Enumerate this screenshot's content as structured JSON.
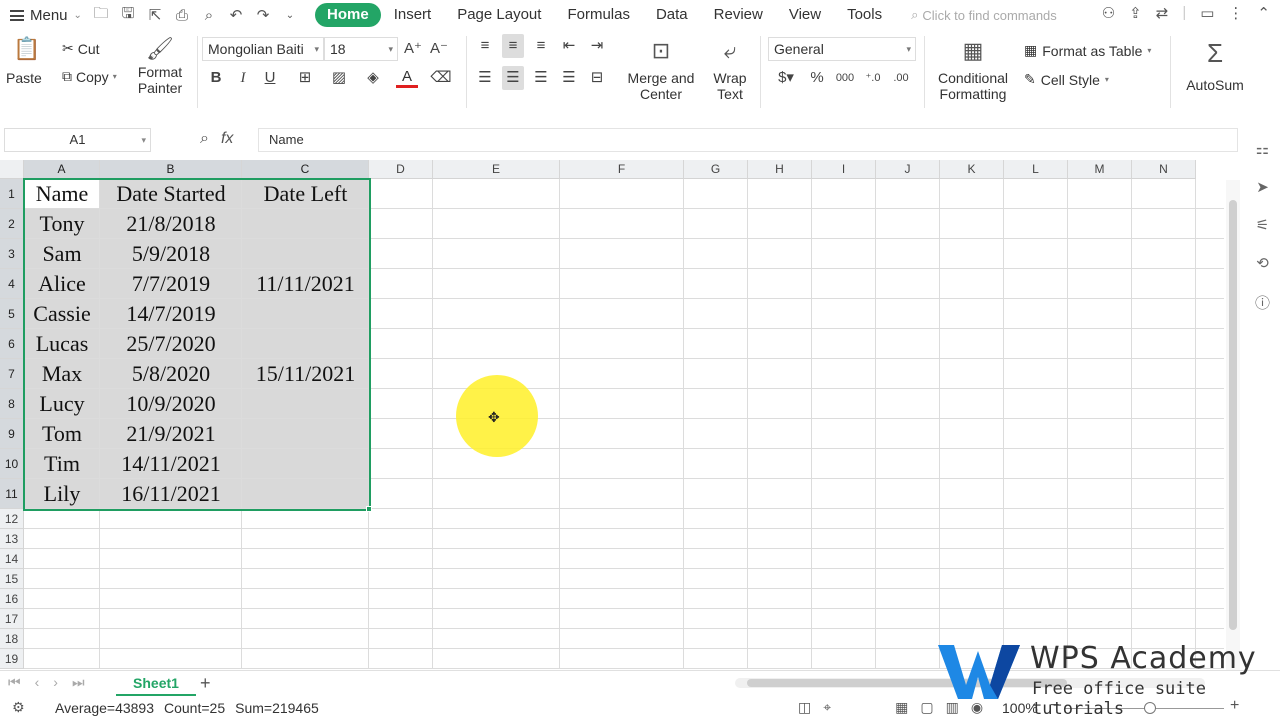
{
  "menubar": {
    "menu_label": "Menu",
    "tabs": [
      {
        "label": "Home",
        "active": true
      },
      {
        "label": "Insert"
      },
      {
        "label": "Page Layout"
      },
      {
        "label": "Formulas"
      },
      {
        "label": "Data"
      },
      {
        "label": "Review"
      },
      {
        "label": "View"
      },
      {
        "label": "Tools"
      }
    ],
    "search_placeholder": "Click to find commands"
  },
  "ribbon": {
    "paste": "Paste",
    "cut": "Cut",
    "copy": "Copy",
    "format_painter_1": "Format",
    "format_painter_2": "Painter",
    "font_name": "Mongolian Baiti",
    "font_size": "18",
    "merge_1": "Merge and",
    "merge_2": "Center",
    "wrap_1": "Wrap",
    "wrap_2": "Text",
    "number_format": "General",
    "conditional_1": "Conditional",
    "conditional_2": "Formatting",
    "format_as_table": "Format as Table",
    "cell_style": "Cell Style",
    "autosum": "AutoSum",
    "bold": "B",
    "italic": "I",
    "underline": "U",
    "percent": "%"
  },
  "formula_bar": {
    "name_box": "A1",
    "fx": "fx",
    "content": "Name"
  },
  "grid": {
    "columns": [
      "A",
      "B",
      "C",
      "D",
      "E",
      "F",
      "G",
      "H",
      "I",
      "J",
      "K",
      "L",
      "M",
      "N"
    ],
    "rows": [
      "1",
      "2",
      "3",
      "4",
      "5",
      "6",
      "7",
      "8",
      "9",
      "10",
      "11",
      "12",
      "13",
      "14",
      "15",
      "16",
      "17",
      "18",
      "19"
    ],
    "headers": [
      "Name",
      "Date Started",
      "Date Left"
    ],
    "data": [
      [
        "Tony",
        "21/8/2018",
        ""
      ],
      [
        "Sam",
        "5/9/2018",
        ""
      ],
      [
        "Alice",
        "7/7/2019",
        "11/11/2021"
      ],
      [
        "Cassie",
        "14/7/2019",
        ""
      ],
      [
        "Lucas",
        "25/7/2020",
        ""
      ],
      [
        "Max",
        "5/8/2020",
        "15/11/2021"
      ],
      [
        "Lucy",
        "10/9/2020",
        ""
      ],
      [
        "Tom",
        "21/9/2021",
        ""
      ],
      [
        "Tim",
        "14/11/2021",
        ""
      ],
      [
        "Lily",
        "16/11/2021",
        ""
      ]
    ]
  },
  "sheets": {
    "active": "Sheet1"
  },
  "status": {
    "average": "Average=43893",
    "count": "Count=25",
    "sum": "Sum=219465",
    "zoom": "100%"
  },
  "watermark": {
    "title": "WPS Academy",
    "subtitle": "Free office suite tutorials"
  },
  "colors": {
    "accent": "#23a566",
    "selection_border": "#1f9d61",
    "highlight": "#fff028"
  }
}
